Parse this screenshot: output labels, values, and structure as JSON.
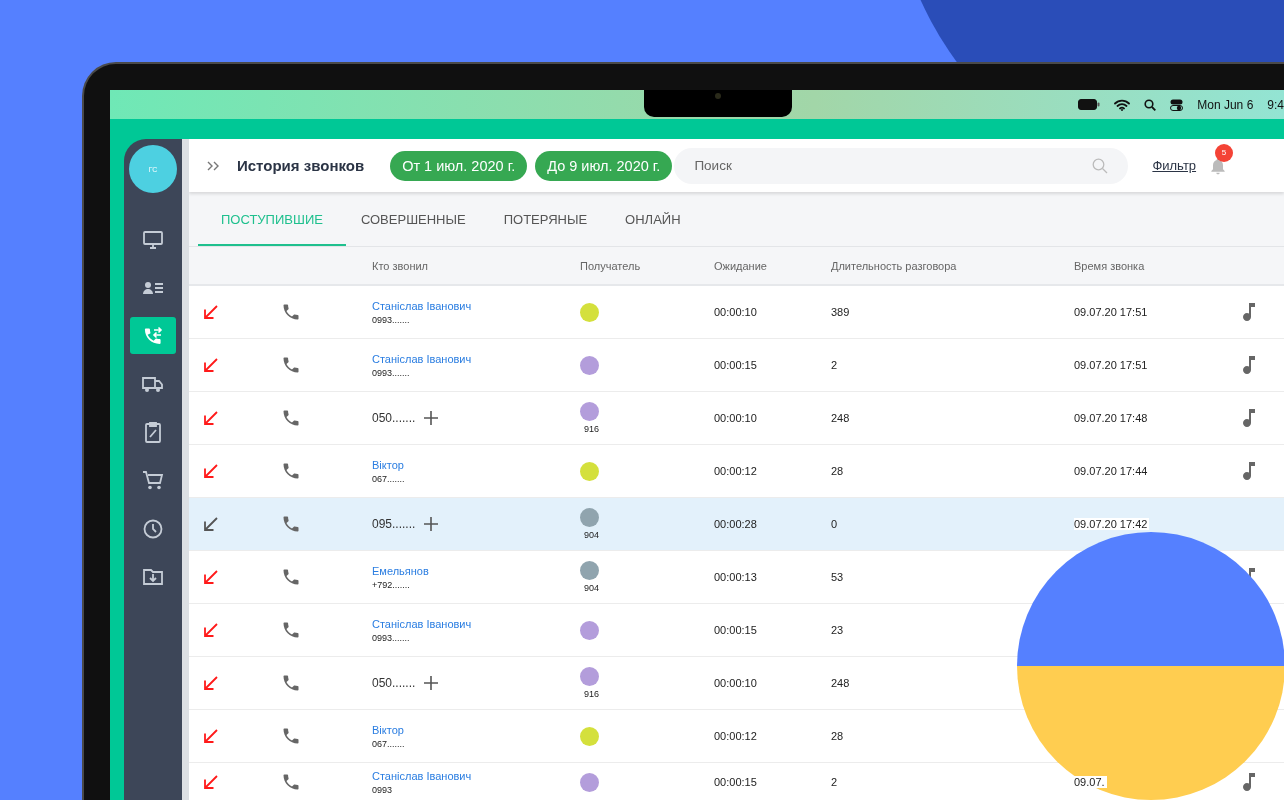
{
  "menu_bar": {
    "date": "Mon Jun 6",
    "time": "9:4"
  },
  "sidebar": {
    "avatar": "ГС",
    "items": [
      {
        "kind": "monitor",
        "selected": false
      },
      {
        "kind": "contacts",
        "selected": false
      },
      {
        "kind": "calls",
        "selected": true
      },
      {
        "kind": "truck",
        "selected": false
      },
      {
        "kind": "clipboard",
        "selected": false
      },
      {
        "kind": "cart",
        "selected": false
      },
      {
        "kind": "clock",
        "selected": false
      },
      {
        "kind": "folder",
        "selected": false
      }
    ]
  },
  "header": {
    "title": "История звонков",
    "date_from": "От 1 июл. 2020 г.",
    "date_to": "До 9 июл. 2020 г.",
    "search": {
      "placeholder": "Поиск"
    },
    "filter": "Фильтр",
    "notifications": "5"
  },
  "tabs": [
    {
      "label": "ПОСТУПИВШИЕ",
      "selected": true
    },
    {
      "label": "СОВЕРШЕННЫЕ",
      "selected": false
    },
    {
      "label": "ПОТЕРЯНЫЕ",
      "selected": false
    },
    {
      "label": "ОНЛАЙН",
      "selected": false
    }
  ],
  "table": {
    "columns": [
      "Кто звонил",
      "Получатель",
      "Ожидание",
      "Длительность разговора",
      "Время звонка"
    ],
    "rows": [
      {
        "missed": true,
        "selected": false,
        "caller": {
          "kind": "contact",
          "name": "Станіслав Іванович",
          "phone": "0993......."
        },
        "recipient": {
          "color": "#d4e03c"
        },
        "wait": "00:00:10",
        "duration": "389",
        "time": "09.07.20 17:51",
        "recording": true
      },
      {
        "missed": true,
        "selected": false,
        "caller": {
          "kind": "contact",
          "name": "Станіслав Іванович",
          "phone": "0993......."
        },
        "recipient": {
          "color": "#b39ddb"
        },
        "wait": "00:00:15",
        "duration": "2",
        "time": "09.07.20 17:51",
        "recording": true
      },
      {
        "missed": true,
        "selected": false,
        "caller": {
          "kind": "number",
          "phone": "050......."
        },
        "recipient": {
          "color": "#b39ddb",
          "extension": "916"
        },
        "wait": "00:00:10",
        "duration": "248",
        "time": "09.07.20 17:48",
        "recording": true
      },
      {
        "missed": true,
        "selected": false,
        "caller": {
          "kind": "contact",
          "name": "Віктор",
          "phone": "067......."
        },
        "recipient": {
          "color": "#d4e03c"
        },
        "wait": "00:00:12",
        "duration": "28",
        "time": "09.07.20 17:44",
        "recording": true
      },
      {
        "missed": false,
        "selected": true,
        "caller": {
          "kind": "number",
          "phone": "095......."
        },
        "recipient": {
          "color": "#90a4ae",
          "extension": "904"
        },
        "wait": "00:00:28",
        "duration": "0",
        "time": "09.07.20 17:42",
        "recording": false
      },
      {
        "missed": true,
        "selected": false,
        "caller": {
          "kind": "contact",
          "name": "Емельянов",
          "phone": "+792......."
        },
        "recipient": {
          "color": "#90a4ae",
          "extension": "904"
        },
        "wait": "00:00:13",
        "duration": "53",
        "recording": true
      },
      {
        "missed": true,
        "selected": false,
        "caller": {
          "kind": "contact",
          "name": "Станіслав Іванович",
          "phone": "0993......."
        },
        "recipient": {
          "color": "#b39ddb"
        },
        "wait": "00:00:15",
        "duration": "23"
      },
      {
        "missed": true,
        "selected": false,
        "caller": {
          "kind": "number",
          "phone": "050......."
        },
        "recipient": {
          "color": "#b39ddb",
          "extension": "916"
        },
        "wait": "00:00:10",
        "duration": "248"
      },
      {
        "missed": true,
        "selected": false,
        "caller": {
          "kind": "contact",
          "name": "Віктор",
          "phone": "067......."
        },
        "recipient": {
          "color": "#d4e03c"
        },
        "wait": "00:00:12",
        "duration": "28"
      },
      {
        "missed": true,
        "selected": false,
        "caller": {
          "kind": "contact",
          "name": "Станіслав Іванович",
          "phone": "0993"
        },
        "recipient": {
          "color": "#b39ddb"
        },
        "wait": "00:00:15",
        "duration": "2",
        "time": "09.07.",
        "recording": true
      }
    ]
  }
}
